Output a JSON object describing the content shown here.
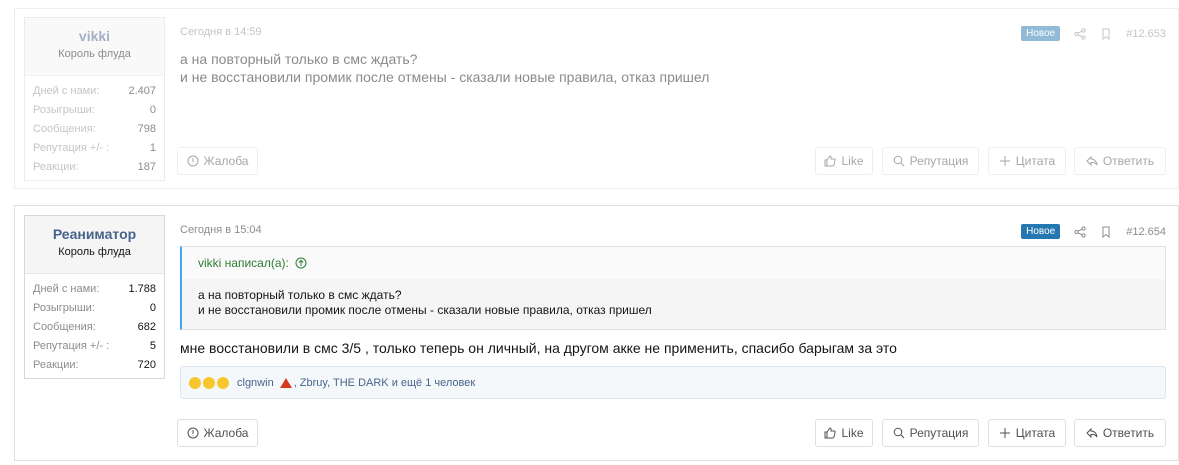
{
  "posts": [
    {
      "username": "vikki",
      "user_title": "Король флуда",
      "stats": [
        {
          "label": "Дней с нами:",
          "value": "2.407"
        },
        {
          "label": "Розыгрыши:",
          "value": "0"
        },
        {
          "label": "Сообщения:",
          "value": "798"
        },
        {
          "label": "Репутация +/- :",
          "value": "1"
        },
        {
          "label": "Реакции:",
          "value": "187"
        }
      ],
      "date": "Сегодня в 14:59",
      "badge": "Новое",
      "number": "#12.653",
      "message_line1": "а на повторный только в смс ждать?",
      "message_line2": "и не восстановили промик после отмены - сказали новые правила, отказ пришел",
      "buttons": {
        "report": "Жалоба",
        "like": "Like",
        "reputation": "Репутация",
        "quote": "Цитата",
        "reply": "Ответить"
      }
    },
    {
      "username": "Реаниматор",
      "user_title": "Король флуда",
      "stats": [
        {
          "label": "Дней с нами:",
          "value": "1.788"
        },
        {
          "label": "Розыгрыши:",
          "value": "0"
        },
        {
          "label": "Сообщения:",
          "value": "682"
        },
        {
          "label": "Репутация +/- :",
          "value": "5"
        },
        {
          "label": "Реакции:",
          "value": "720"
        }
      ],
      "date": "Сегодня в 15:04",
      "badge": "Новое",
      "number": "#12.654",
      "quote_author": "vikki написал(а):",
      "quote_line1": "а на повторный только в смс ждать?",
      "quote_line2": "и не восстановили промик после отмены - сказали новые правила, отказ пришел",
      "message": "мне восстановили в смс 3/5 , только теперь он личный, на другом акке не применить, спасибо барыгам за это",
      "reactions_user1": "clgnwin",
      "reactions_rest": ", Zbruy, THE DARK и ещё 1 человек",
      "buttons": {
        "report": "Жалоба",
        "like": "Like",
        "reputation": "Репутация",
        "quote": "Цитата",
        "reply": "Ответить"
      }
    }
  ],
  "colors": {
    "accent": "#2577b1",
    "username": "#47648b",
    "quote_bar": "#47a7eb",
    "quote_author": "#2e7d32"
  }
}
